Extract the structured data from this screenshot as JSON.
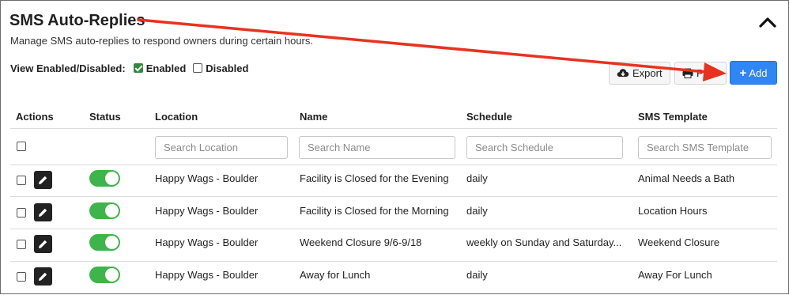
{
  "section": {
    "title": "SMS Auto-Replies",
    "subtitle": "Manage SMS auto-replies to respond owners during certain hours."
  },
  "filter": {
    "label": "View Enabled/Disabled:",
    "options": [
      {
        "label": "Enabled",
        "checked": true
      },
      {
        "label": "Disabled",
        "checked": false
      }
    ]
  },
  "toolbar": {
    "export_label": "Export",
    "print_label": "Print",
    "add_label": "Add"
  },
  "table": {
    "columns": [
      "Actions",
      "Status",
      "Location",
      "Name",
      "Schedule",
      "SMS Template"
    ],
    "search_placeholders": {
      "location": "Search Location",
      "name": "Search Name",
      "schedule": "Search Schedule",
      "template": "Search SMS Template"
    },
    "rows": [
      {
        "location": "Happy Wags - Boulder",
        "name": "Facility is Closed for the Evening",
        "schedule": "daily",
        "template": "Animal Needs a Bath",
        "enabled": true
      },
      {
        "location": "Happy Wags - Boulder",
        "name": "Facility is Closed for the Morning",
        "schedule": "daily",
        "template": "Location Hours",
        "enabled": true
      },
      {
        "location": "Happy Wags - Boulder",
        "name": "Weekend Closure 9/6-9/18",
        "schedule": "weekly on Sunday and Saturday...",
        "template": "Weekend Closure",
        "enabled": true
      },
      {
        "location": "Happy Wags - Boulder",
        "name": "Away for Lunch",
        "schedule": "daily",
        "template": "Away For Lunch",
        "enabled": true
      }
    ]
  },
  "icons": {
    "collapse": "chevron-up-icon",
    "export": "cloud-download-icon",
    "print": "printer-icon",
    "add": "plus-icon",
    "edit": "pencil-icon"
  },
  "colors": {
    "accent": "#2f86f6",
    "toggle_on": "#3db54a",
    "checkbox_checked": "#2e8b3a",
    "annotation_arrow": "#e8321f"
  }
}
